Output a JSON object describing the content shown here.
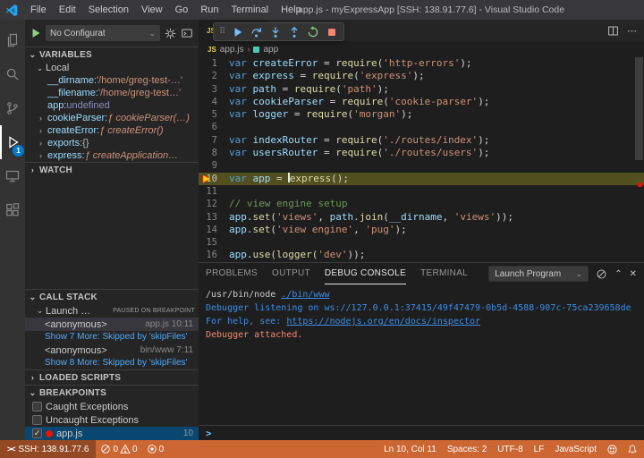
{
  "colors": {
    "status-bg": "#cc6633",
    "badge-bg": "#007acc",
    "accent": "#007acc",
    "breakpoint": "#e51400",
    "active-line-bg": "#51501e",
    "keyword": "#569cd6",
    "variable": "#9cdcfe",
    "function": "#dcdcaa",
    "string": "#ce9178",
    "comment": "#6a9955",
    "info-text": "#3b8eea",
    "error-text": "#f48771"
  },
  "titlebar": {
    "title": "app.js - myExpressApp [SSH: 138.91.77.6] - Visual Studio Code",
    "menus": [
      "File",
      "Edit",
      "Selection",
      "View",
      "Go",
      "Run",
      "Terminal",
      "Help"
    ]
  },
  "activity_bar": {
    "items": [
      "explorer-icon",
      "search-icon",
      "source-control-icon",
      "run-and-debug-icon",
      "remote-explorer-icon",
      "extensions-icon"
    ],
    "active_item": "run-and-debug",
    "debug_badge": "1"
  },
  "sidebar": {
    "toolbar": {
      "config_label": "No Configurat"
    },
    "variables": {
      "title": "VARIABLES",
      "scope": "Local",
      "items": [
        {
          "name": "__dirname",
          "value": "'/home/greg-test-…'",
          "kind": "string",
          "expandable": false
        },
        {
          "name": "__filename",
          "value": "'/home/greg-test…'",
          "kind": "string",
          "expandable": false
        },
        {
          "name": "app",
          "value": "undefined",
          "kind": "undefined",
          "expandable": false
        },
        {
          "name": "cookieParser",
          "value": "ƒ cookieParser(…)",
          "kind": "function",
          "expandable": true
        },
        {
          "name": "createError",
          "value": "ƒ createError()",
          "kind": "function",
          "expandable": true
        },
        {
          "name": "exports",
          "value": "{}",
          "kind": "object",
          "expandable": true
        },
        {
          "name": "express",
          "value": "ƒ createApplication…",
          "kind": "function",
          "expandable": true
        }
      ]
    },
    "watch": {
      "title": "WATCH"
    },
    "call_stack": {
      "title": "CALL STACK",
      "thread_label": "Launch …",
      "thread_badge": "PAUSED ON BREAKPOINT",
      "frames": [
        {
          "label": "<anonymous>",
          "file": "app.js",
          "line": "10:11",
          "selected": true
        },
        {
          "link": "Show 7 More: Skipped by 'skipFiles'"
        },
        {
          "label": "<anonymous>",
          "file": "bin/www",
          "line": "7:11",
          "selected": false
        },
        {
          "link": "Show 8 More: Skipped by 'skipFiles'"
        }
      ]
    },
    "loaded_scripts": {
      "title": "LOADED SCRIPTS"
    },
    "breakpoints": {
      "title": "BREAKPOINTS",
      "items": [
        {
          "label": "Caught Exceptions",
          "checked": false,
          "type": "exception",
          "selected": false
        },
        {
          "label": "Uncaught Exceptions",
          "checked": false,
          "type": "exception",
          "selected": false
        },
        {
          "label": "app.js",
          "checked": true,
          "type": "source",
          "line": "10",
          "selected": true
        }
      ]
    }
  },
  "editor": {
    "tab": {
      "label": "app.js",
      "icon": "javascript-file",
      "icon_text": "JS"
    },
    "breadcrumb": {
      "file": "app.js",
      "symbol": "app"
    },
    "active_line": 10,
    "cursor": "Ln 10, Col 11",
    "lines": [
      {
        "n": 1,
        "tokens": [
          [
            "k",
            "var "
          ],
          [
            "v",
            "createError"
          ],
          [
            "o",
            " = "
          ],
          [
            "f",
            "require"
          ],
          [
            "o",
            "("
          ],
          [
            "s",
            "'http-errors'"
          ],
          [
            "o",
            ");"
          ]
        ]
      },
      {
        "n": 2,
        "tokens": [
          [
            "k",
            "var "
          ],
          [
            "v",
            "express"
          ],
          [
            "o",
            " = "
          ],
          [
            "f",
            "require"
          ],
          [
            "o",
            "("
          ],
          [
            "s",
            "'express'"
          ],
          [
            "o",
            ");"
          ]
        ]
      },
      {
        "n": 3,
        "tokens": [
          [
            "k",
            "var "
          ],
          [
            "v",
            "path"
          ],
          [
            "o",
            " = "
          ],
          [
            "f",
            "require"
          ],
          [
            "o",
            "("
          ],
          [
            "s",
            "'path'"
          ],
          [
            "o",
            ");"
          ]
        ]
      },
      {
        "n": 4,
        "tokens": [
          [
            "k",
            "var "
          ],
          [
            "v",
            "cookieParser"
          ],
          [
            "o",
            " = "
          ],
          [
            "f",
            "require"
          ],
          [
            "o",
            "("
          ],
          [
            "s",
            "'cookie-parser'"
          ],
          [
            "o",
            ");"
          ]
        ]
      },
      {
        "n": 5,
        "tokens": [
          [
            "k",
            "var "
          ],
          [
            "v",
            "logger"
          ],
          [
            "o",
            " = "
          ],
          [
            "f",
            "require"
          ],
          [
            "o",
            "("
          ],
          [
            "s",
            "'morgan'"
          ],
          [
            "o",
            ");"
          ]
        ]
      },
      {
        "n": 6,
        "tokens": []
      },
      {
        "n": 7,
        "tokens": [
          [
            "k",
            "var "
          ],
          [
            "v",
            "indexRouter"
          ],
          [
            "o",
            " = "
          ],
          [
            "f",
            "require"
          ],
          [
            "o",
            "("
          ],
          [
            "s",
            "'./routes/index'"
          ],
          [
            "o",
            ");"
          ]
        ]
      },
      {
        "n": 8,
        "tokens": [
          [
            "k",
            "var "
          ],
          [
            "v",
            "usersRouter"
          ],
          [
            "o",
            " = "
          ],
          [
            "f",
            "require"
          ],
          [
            "o",
            "("
          ],
          [
            "s",
            "'./routes/users'"
          ],
          [
            "o",
            ");"
          ]
        ]
      },
      {
        "n": 9,
        "tokens": []
      },
      {
        "n": 10,
        "tokens": [
          [
            "k",
            "var "
          ],
          [
            "v",
            "app"
          ],
          [
            "o",
            " = "
          ],
          [
            "caret",
            ""
          ],
          [
            "f",
            "express"
          ],
          [
            "o",
            "();"
          ]
        ]
      },
      {
        "n": 11,
        "tokens": []
      },
      {
        "n": 12,
        "tokens": [
          [
            "c",
            "// view engine setup"
          ]
        ]
      },
      {
        "n": 13,
        "tokens": [
          [
            "v",
            "app"
          ],
          [
            "o",
            "."
          ],
          [
            "f",
            "set"
          ],
          [
            "o",
            "("
          ],
          [
            "s",
            "'views'"
          ],
          [
            "o",
            ", "
          ],
          [
            "v",
            "path"
          ],
          [
            "o",
            "."
          ],
          [
            "f",
            "join"
          ],
          [
            "o",
            "("
          ],
          [
            "v",
            "__dirname"
          ],
          [
            "o",
            ", "
          ],
          [
            "s",
            "'views'"
          ],
          [
            "o",
            "));"
          ]
        ]
      },
      {
        "n": 14,
        "tokens": [
          [
            "v",
            "app"
          ],
          [
            "o",
            "."
          ],
          [
            "f",
            "set"
          ],
          [
            "o",
            "("
          ],
          [
            "s",
            "'view engine'"
          ],
          [
            "o",
            ", "
          ],
          [
            "s",
            "'pug'"
          ],
          [
            "o",
            ");"
          ]
        ]
      },
      {
        "n": 15,
        "tokens": []
      },
      {
        "n": 16,
        "tokens": [
          [
            "v",
            "app"
          ],
          [
            "o",
            "."
          ],
          [
            "f",
            "use"
          ],
          [
            "o",
            "("
          ],
          [
            "f",
            "logger"
          ],
          [
            "o",
            "("
          ],
          [
            "s",
            "'dev'"
          ],
          [
            "o",
            "));"
          ]
        ]
      }
    ]
  },
  "debug_toolbar": {
    "actions": [
      "continue",
      "step-over",
      "step-into",
      "step-out",
      "restart",
      "stop"
    ]
  },
  "panel": {
    "tabs": [
      {
        "label": "PROBLEMS",
        "active": false
      },
      {
        "label": "OUTPUT",
        "active": false
      },
      {
        "label": "DEBUG CONSOLE",
        "active": true
      },
      {
        "label": "TERMINAL",
        "active": false
      }
    ],
    "dropdown": "Launch Program",
    "console_lines": [
      [
        [
          "plain",
          "/usr/bin/node "
        ],
        [
          "link",
          "./bin/www"
        ]
      ],
      [
        [
          "info",
          "Debugger listening on ws://127.0.0.1:37415/49f47479-0b5d-4588-907c-75ca239658de"
        ]
      ],
      [
        [
          "info",
          "For help, see: "
        ],
        [
          "link",
          "https://nodejs.org/en/docs/inspector"
        ]
      ],
      [
        [
          "error",
          "Debugger attached."
        ]
      ]
    ],
    "prompt": ">"
  },
  "statusbar": {
    "remote": "SSH: 138.91.77.6",
    "errors": "0",
    "warnings": "0",
    "ports": "0",
    "right": [
      {
        "name": "cursor-position",
        "label": "Ln 10, Col 11"
      },
      {
        "name": "indentation",
        "label": "Spaces: 2"
      },
      {
        "name": "encoding",
        "label": "UTF-8"
      },
      {
        "name": "eol",
        "label": "LF"
      },
      {
        "name": "language-mode",
        "label": "JavaScript"
      }
    ]
  }
}
